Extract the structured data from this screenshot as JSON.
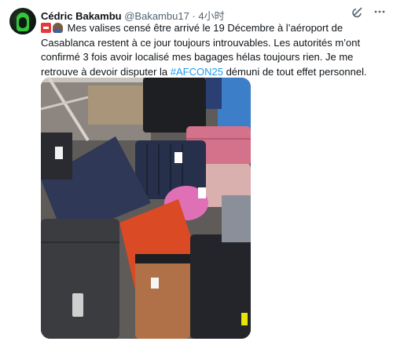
{
  "tweet": {
    "author_name": "Cédric Bakambu",
    "handle": "@Bakambu17",
    "separator": "·",
    "timestamp": "4小时",
    "text_part1": " Mes valises censé être arrivé le 19 Décembre à l’aéroport de Casablanca restent à ce jour toujours introuvables. Les autorités m’ont confirmé 3 fois avoir localisé mes bagages hélas toujours rien. Je me retrouve à devoir disputer la ",
    "hashtag": "#AFCON25",
    "text_part2": " démuni de tout effet personnel.",
    "emojis": [
      "sos-emoji",
      "man-emoji"
    ],
    "header_icons": [
      "grok-icon",
      "more-icon"
    ],
    "photo_subject": "pile of luggage suitcases",
    "colors": {
      "hashtag": "#1d9bf0",
      "secondary_text": "#536471",
      "primary_text": "#0f1419"
    }
  }
}
